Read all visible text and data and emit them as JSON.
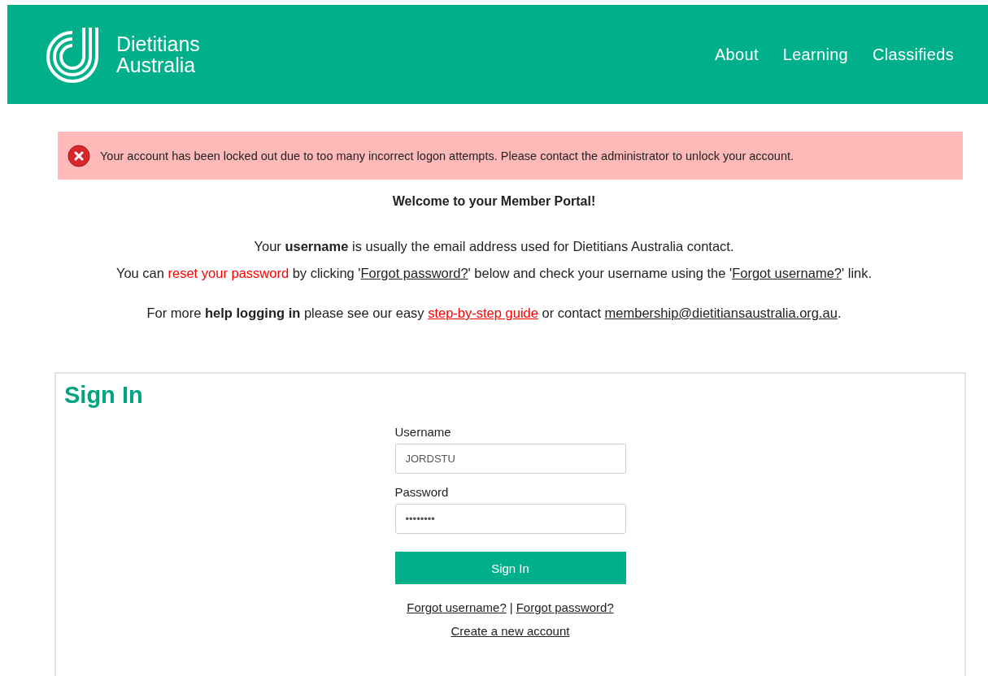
{
  "header": {
    "logo_line_1": "Dietitians",
    "logo_line_2": "Australia",
    "nav": [
      {
        "label": "About"
      },
      {
        "label": "Learning"
      },
      {
        "label": "Classifieds"
      }
    ]
  },
  "alert": {
    "message": "Your account has been locked out due to too many incorrect logon attempts. Please contact the administrator to unlock your account."
  },
  "welcome": "Welcome to your Member Portal!",
  "paragraphs": [
    {
      "segments": [
        {
          "kind": "text",
          "text": "Your "
        },
        {
          "kind": "bold",
          "text": "username"
        },
        {
          "kind": "text",
          "text": " is usually the email address used for Dietitians Australia contact."
        }
      ]
    },
    {
      "segments": [
        {
          "kind": "text",
          "text": "You can "
        },
        {
          "kind": "em",
          "text": "reset your password"
        },
        {
          "kind": "text",
          "text": " by clicking '"
        },
        {
          "kind": "link",
          "text": "Forgot password?"
        },
        {
          "kind": "text",
          "text": "' below and check your username using the '"
        },
        {
          "kind": "link",
          "text": "Forgot username?"
        },
        {
          "kind": "text",
          "text": "' link."
        }
      ]
    },
    {
      "segments": [
        {
          "kind": "text",
          "text": "For more "
        },
        {
          "kind": "bold",
          "text": "help logging in"
        },
        {
          "kind": "text",
          "text": " please see our easy "
        },
        {
          "kind": "red_link",
          "text": "step-by-step guide"
        },
        {
          "kind": "text",
          "text": " or contact "
        },
        {
          "kind": "link",
          "text": "membership@dietitiansaustralia.org.au"
        },
        {
          "kind": "text",
          "text": "."
        }
      ]
    }
  ],
  "sign_in": {
    "title": "Sign In",
    "username_label": "Username",
    "username_value": "JORDSTU",
    "password_label": "Password",
    "password_value": "••••••••",
    "button": "Sign In",
    "forgot_username": "Forgot username?",
    "separator": "|",
    "forgot_password": "Forgot password?",
    "create_account": "Create a new account"
  }
}
